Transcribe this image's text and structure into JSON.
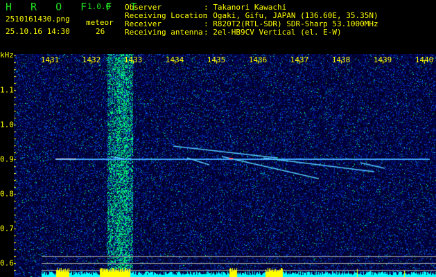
{
  "app": {
    "title": "H R O F F T",
    "version": "1.0.0"
  },
  "file": {
    "name": "2510161430.png",
    "datetime": "25.10.16 14:30"
  },
  "meteor": {
    "label": "meteor",
    "count": "26"
  },
  "info": [
    {
      "label": "Observer",
      "value": ": Takanori Kawachi"
    },
    {
      "label": "Receiving Location",
      "value": ": Ogaki, Gifu, JAPAN (136.60E, 35.35N)"
    },
    {
      "label": "Receiver",
      "value": ": R820T2(RTL-SDR) SDR-Sharp 53.1000MHz"
    },
    {
      "label": "Receiving antenna",
      "value": ": 2el-HB9CV Vertical (el. E-W)"
    }
  ],
  "axis": {
    "unit": "kHz",
    "x_ticks": [
      "1431",
      "1432",
      "1433",
      "1434",
      "1435",
      "1436",
      "1437",
      "1438",
      "1439",
      "1440"
    ],
    "y_ticks": [
      "1.1",
      "1.0",
      "0.9",
      "0.8",
      "0.7",
      "0.6"
    ]
  },
  "colors": {
    "text": "#ffff00",
    "title": "#22dd22",
    "histogram_high": "#ffff00",
    "histogram_low": "#00ffff"
  }
}
